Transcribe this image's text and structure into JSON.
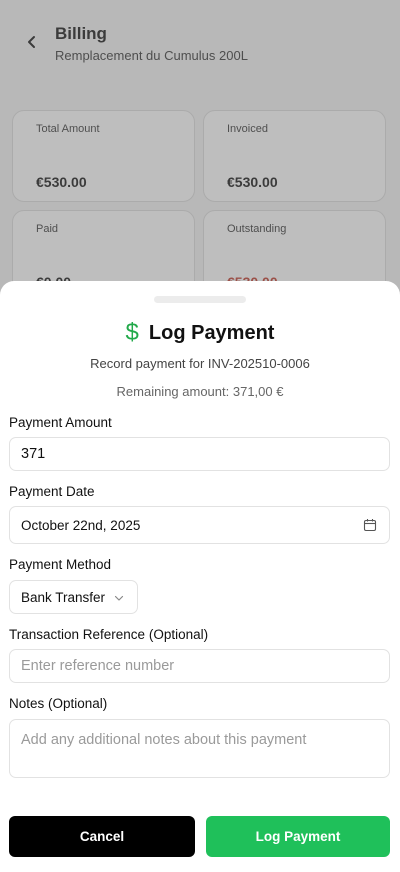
{
  "header": {
    "title": "Billing",
    "subtitle": "Remplacement du Cumulus 200L"
  },
  "summary_cards": [
    {
      "label": "Total Amount",
      "value": "€530.00"
    },
    {
      "label": "Invoiced",
      "value": "€530.00"
    },
    {
      "label": "Paid",
      "value": "€0.00"
    },
    {
      "label": "Outstanding",
      "value": "€530.00"
    }
  ],
  "sheet": {
    "title": "Log Payment",
    "description": "Record payment for INV-202510-0006",
    "remaining": "Remaining amount: 371,00 €",
    "payment_amount": {
      "label": "Payment Amount",
      "value": "371"
    },
    "payment_date": {
      "label": "Payment Date",
      "value": "October 22nd, 2025"
    },
    "payment_method": {
      "label": "Payment Method",
      "value": "Bank Transfer"
    },
    "transaction_reference": {
      "label": "Transaction Reference (Optional)",
      "placeholder": "Enter reference number"
    },
    "notes": {
      "label": "Notes (Optional)",
      "placeholder": "Add any additional notes about this payment"
    },
    "cancel_label": "Cancel",
    "submit_label": "Log Payment"
  },
  "colors": {
    "accent_green": "#1fc05a",
    "outstanding_red": "#c0392b"
  }
}
